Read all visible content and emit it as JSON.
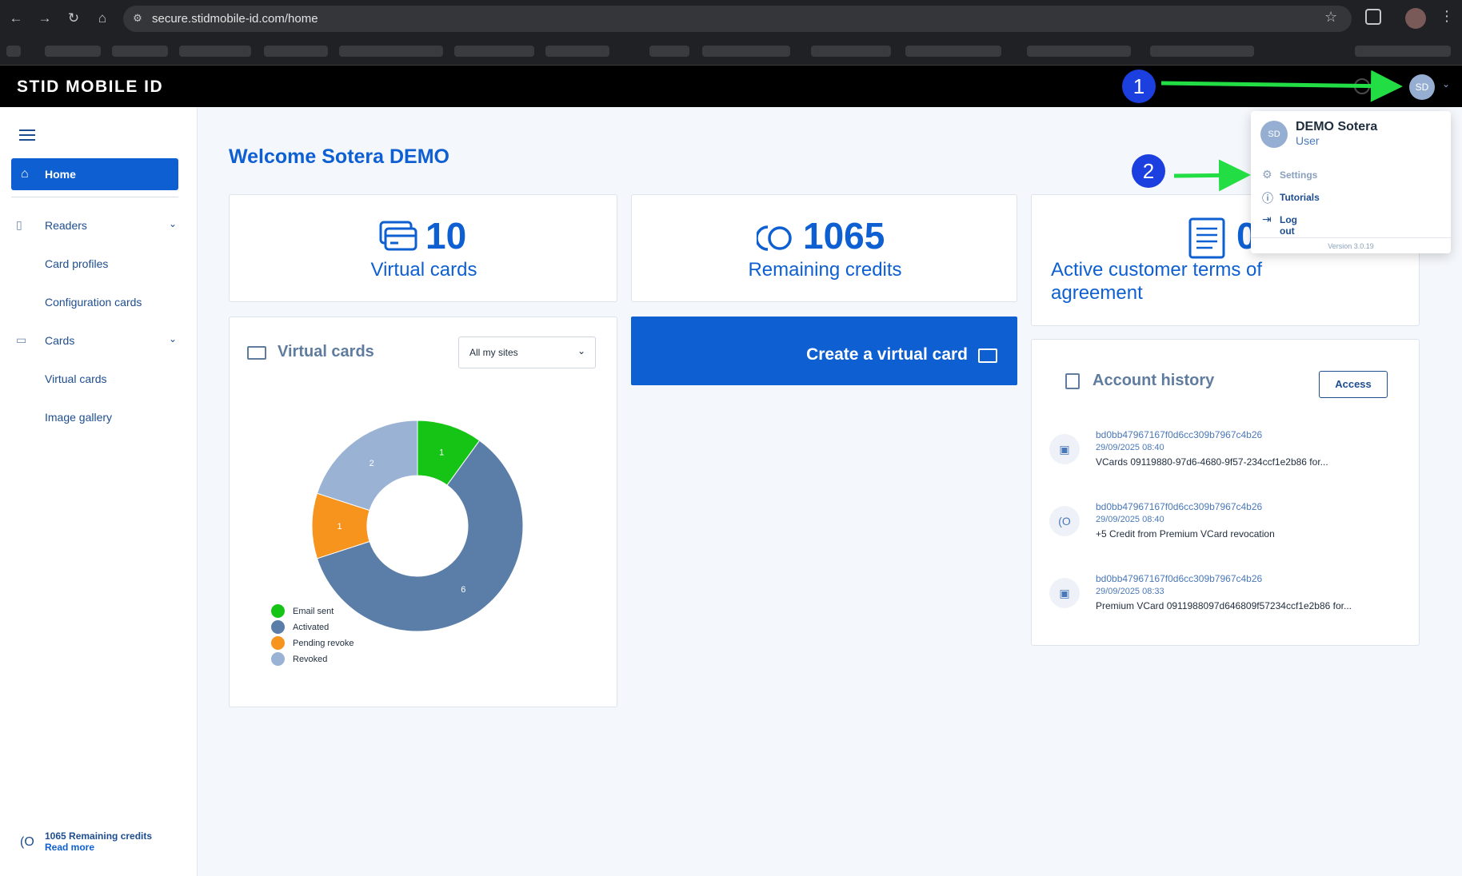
{
  "browser": {
    "url": "secure.stidmobile-id.com/home"
  },
  "header": {
    "logo": "STID MOBILE ID",
    "avatar_initials": "SD"
  },
  "sidebar": {
    "home": "Home",
    "readers": "Readers",
    "card_profiles": "Card profiles",
    "configuration_cards": "Configuration cards",
    "cards": "Cards",
    "virtual_cards": "Virtual cards",
    "image_gallery": "Image gallery",
    "footer_credits": "1065 Remaining credits",
    "footer_link": "Read more"
  },
  "main": {
    "welcome": "Welcome Sotera DEMO",
    "stats": [
      {
        "value": "10",
        "label": "Virtual cards"
      },
      {
        "value": "1065",
        "label": "Remaining credits"
      },
      {
        "value": "0",
        "label_line1": "Active customer terms of",
        "label_line2": "agreement"
      }
    ],
    "virtual_cards_panel": {
      "title": "Virtual cards",
      "site_filter": "All my sites"
    },
    "create_button": "Create a virtual card",
    "account_history": {
      "title": "Account history",
      "access_button": "Access",
      "items": [
        {
          "id": "bd0bb47967167f0d6cc309b7967c4b26",
          "date": "29/09/2025 08:40",
          "desc": "VCards 09119880-97d6-4680-9f57-234ccf1e2b86 for..."
        },
        {
          "id": "bd0bb47967167f0d6cc309b7967c4b26",
          "date": "29/09/2025 08:40",
          "desc": "+5 Credit from Premium VCard revocation"
        },
        {
          "id": "bd0bb47967167f0d6cc309b7967c4b26",
          "date": "29/09/2025 08:33",
          "desc": "Premium VCard 0911988097d646809f57234ccf1e2b86 for..."
        }
      ]
    }
  },
  "chart_data": {
    "type": "pie",
    "subtype": "donut",
    "categories": [
      "Email sent",
      "Activated",
      "Pending revoke",
      "Revoked"
    ],
    "values": [
      1,
      6,
      1,
      2
    ],
    "colors": [
      "#16c416",
      "#5b7ea8",
      "#f7941d",
      "#9ab3d5"
    ],
    "legend_position": "bottom-left"
  },
  "user_menu": {
    "name": "DEMO Sotera",
    "role": "User",
    "initials": "SD",
    "items": [
      "Settings",
      "Tutorials",
      "Log out"
    ],
    "version": "Version 3.0.19"
  },
  "annotations": {
    "badge1": "1",
    "badge2": "2",
    "arrow_color": "#22dd44"
  }
}
